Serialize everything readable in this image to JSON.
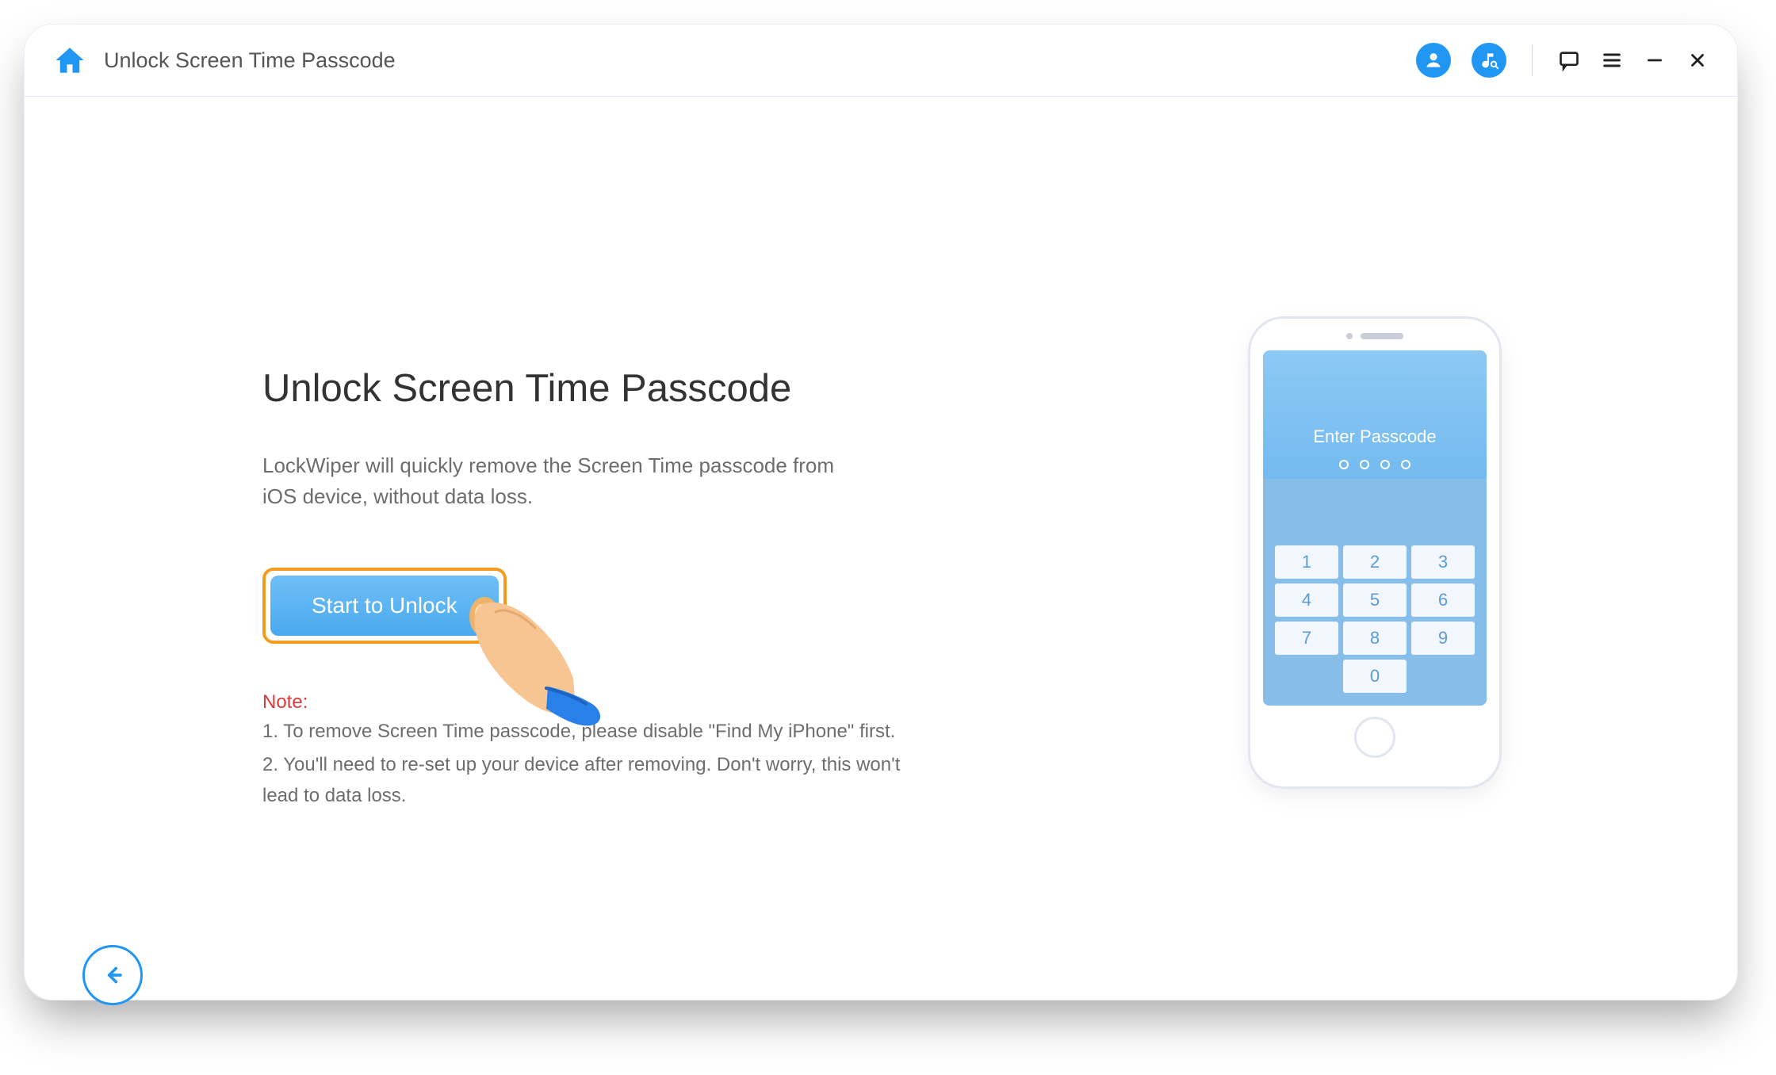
{
  "topbar": {
    "title": "Unlock Screen Time Passcode"
  },
  "content": {
    "heading": "Unlock Screen Time Passcode",
    "description": "LockWiper will quickly remove the Screen Time passcode from iOS device, without data loss.",
    "cta_label": "Start to Unlock",
    "note_header": "Note:",
    "note1": "1. To remove Screen Time passcode, please disable \"Find My iPhone\" first.",
    "note2": "2. You'll need to re-set up your device after removing. Don't worry, this won't lead to data loss."
  },
  "phone": {
    "enter_passcode_label": "Enter Passcode",
    "keys": [
      "1",
      "2",
      "3",
      "4",
      "5",
      "6",
      "7",
      "8",
      "9",
      "0"
    ]
  }
}
